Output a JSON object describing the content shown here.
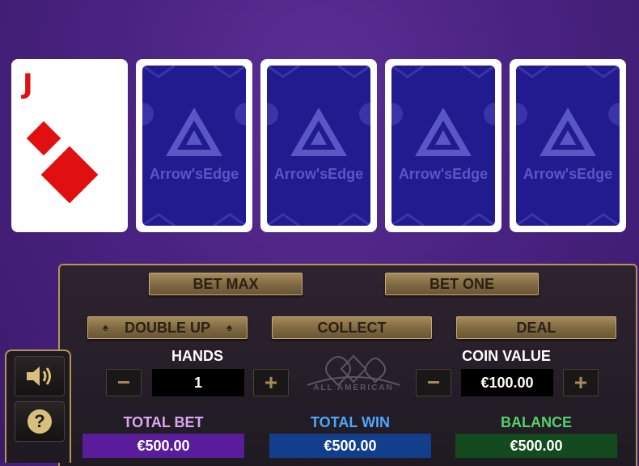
{
  "cards": [
    {
      "rank": "J",
      "suit": "diamonds",
      "face_up": true
    },
    {
      "face_up": false,
      "back_text": "Arrow'sEdge"
    },
    {
      "face_up": false,
      "back_text": "Arrow'sEdge"
    },
    {
      "face_up": false,
      "back_text": "Arrow'sEdge"
    },
    {
      "face_up": false,
      "back_text": "Arrow'sEdge"
    }
  ],
  "buttons": {
    "bet_max": "BET MAX",
    "bet_one": "BET ONE",
    "double_up": "DOUBLE UP",
    "collect": "COLLECT",
    "deal": "DEAL"
  },
  "hands": {
    "label": "HANDS",
    "value": "1",
    "minus": "−",
    "plus": "+"
  },
  "coin_value": {
    "label": "COIN VALUE",
    "value": "€100.00",
    "minus": "−",
    "plus": "+"
  },
  "center_logo": "ALL AMERICAN",
  "meters": {
    "total_bet": {
      "label": "TOTAL BET",
      "value": "€500.00",
      "label_color": "#d9a6f2",
      "box_color": "#5a1c9a"
    },
    "total_win": {
      "label": "TOTAL WIN",
      "value": "€500.00",
      "label_color": "#4da6ff",
      "box_color": "#123e8c"
    },
    "balance": {
      "label": "BALANCE",
      "value": "€500.00",
      "label_color": "#4fd36a",
      "box_color": "#134a1e"
    }
  },
  "side_controls": {
    "sound_icon": "speaker-icon",
    "help_icon": "help-icon",
    "help_symbol": "?"
  },
  "colors": {
    "felt": "#4a2382",
    "card_back": "#221a8f",
    "gold": "#b59552",
    "diamond_red": "#e01010"
  }
}
